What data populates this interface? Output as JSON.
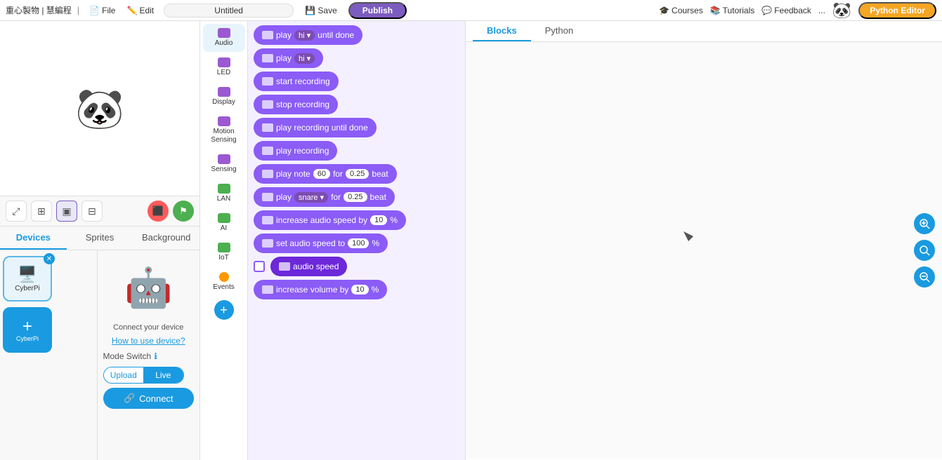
{
  "topbar": {
    "brand_cn": "重心製物 | 慧編程",
    "file_label": "File",
    "edit_label": "Edit",
    "project_name": "Untitled",
    "save_label": "Save",
    "publish_label": "Publish",
    "courses_label": "Courses",
    "tutorials_label": "Tutorials",
    "feedback_label": "Feedback",
    "more_label": "...",
    "python_editor_label": "Python Editor"
  },
  "code_tabs": {
    "blocks_label": "Blocks",
    "python_label": "Python"
  },
  "left_tabs": {
    "devices_label": "Devices",
    "sprites_label": "Sprites",
    "background_label": "Background"
  },
  "device": {
    "name": "CyberPi",
    "connect_text": "Connect",
    "how_to_use": "How to use device?",
    "mode_switch_label": "Mode Switch",
    "upload_label": "Upload",
    "live_label": "Live"
  },
  "sprite": {
    "connect_device_label": "Connect your device"
  },
  "categories": [
    {
      "id": "audio",
      "label": "Audio",
      "color": "#9c59d1"
    },
    {
      "id": "led",
      "label": "LED",
      "color": "#9c59d1"
    },
    {
      "id": "display",
      "label": "Display",
      "color": "#9c59d1"
    },
    {
      "id": "motion_sensing",
      "label": "Motion Sensing",
      "color": "#9c59d1"
    },
    {
      "id": "sensing",
      "label": "Sensing",
      "color": "#9c59d1"
    },
    {
      "id": "lan",
      "label": "LAN",
      "color": "#4caf50"
    },
    {
      "id": "ai",
      "label": "AI",
      "color": "#4caf50"
    },
    {
      "id": "iot",
      "label": "IoT",
      "color": "#4caf50"
    },
    {
      "id": "events",
      "label": "Events",
      "color": "#ff9800"
    }
  ],
  "blocks": [
    {
      "id": "play_hi_until_done",
      "type": "standard",
      "text_parts": [
        "play",
        "hi",
        "until done"
      ],
      "has_dropdown": true
    },
    {
      "id": "play_hi",
      "type": "standard",
      "text_parts": [
        "play",
        "hi"
      ],
      "has_dropdown": true
    },
    {
      "id": "start_recording",
      "type": "standard",
      "text": "start recording"
    },
    {
      "id": "stop_recording",
      "type": "standard",
      "text": "stop recording"
    },
    {
      "id": "play_recording_until_done",
      "type": "standard",
      "text": "play recording until done"
    },
    {
      "id": "play_recording",
      "type": "standard",
      "text": "play recording"
    },
    {
      "id": "play_note",
      "type": "inputs",
      "label": "play note",
      "input1": "60",
      "connector": "for",
      "input2": "0.25",
      "suffix": "beat"
    },
    {
      "id": "play_snare",
      "type": "dropdown_inputs",
      "label": "play",
      "dropdown": "snare",
      "connector": "for",
      "input": "0.25",
      "suffix": "beat"
    },
    {
      "id": "increase_audio_speed",
      "type": "inputs",
      "label": "increase audio speed by",
      "input1": "10",
      "suffix": "%"
    },
    {
      "id": "set_audio_speed",
      "type": "inputs",
      "label": "set audio speed to",
      "input1": "100",
      "suffix": "%"
    },
    {
      "id": "audio_speed",
      "type": "reporter",
      "text": "audio speed",
      "has_checkbox": true
    },
    {
      "id": "increase_volume",
      "type": "inputs",
      "label": "increase volume by",
      "input1": "10",
      "suffix": "%"
    }
  ],
  "zoom_buttons": {
    "zoom_in": "+",
    "zoom_reset": "⊙",
    "zoom_out": "−"
  }
}
